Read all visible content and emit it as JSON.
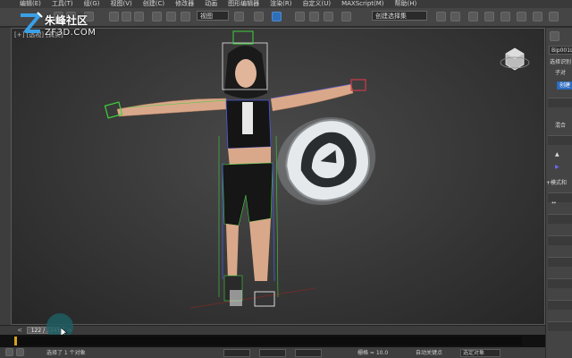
{
  "watermark": {
    "cn_text": "朱峰社区",
    "en_text": "ZF3D.COM"
  },
  "menu": {
    "items": [
      "编辑(E)",
      "工具(T)",
      "组(G)",
      "视图(V)",
      "创建(C)",
      "修改器",
      "动画",
      "图形编辑器",
      "渲染(R)",
      "自定义(U)",
      "MAXScript(M)",
      "帮助(H)"
    ]
  },
  "toolbar": {
    "view_select": "视图",
    "named_select": "创建选择集"
  },
  "viewport": {
    "label": "[+] [透视] [真实]",
    "logo_name": "3ds-max-logo-icon",
    "viewcube_name": "viewcube-icon"
  },
  "right_panel": {
    "object_name": "Bip001L",
    "selection_label": "选择识别",
    "sub_label": "子对",
    "blue_button": "创建",
    "blend_label": "混合",
    "mode_label": "+模式和"
  },
  "timeline": {
    "frame_text": "122 / 5241",
    "prev_label": "<",
    "next_label": ">"
  },
  "status": {
    "selected_text": "选择了 1 个对象",
    "grid_text": "栅格 = 10.0",
    "auto_key": "自动关键点",
    "set_key_select": "选定对象"
  },
  "colors": {
    "accent_blue": "#2d6cc0",
    "trackbar_gold": "#d4a11e",
    "biped_green": "#3fd13f",
    "biped_blue": "#4a5be0"
  }
}
